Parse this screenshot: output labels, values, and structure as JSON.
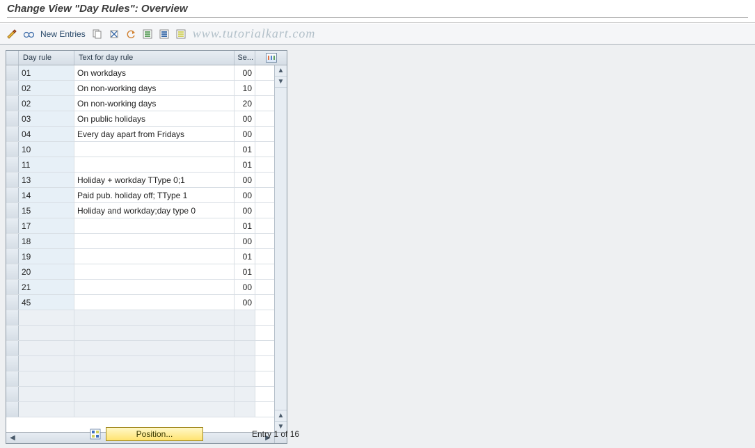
{
  "title": "Change View \"Day Rules\": Overview",
  "toolbar": {
    "new_entries_label": "New Entries"
  },
  "watermark": "www.tutorialkart.com",
  "headers": {
    "day_rule": "Day rule",
    "text": "Text for day rule",
    "se": "Se..."
  },
  "rows": [
    {
      "rule": "01",
      "text": "On workdays",
      "se": "00"
    },
    {
      "rule": "02",
      "text": "On non-working days",
      "se": "10"
    },
    {
      "rule": "02",
      "text": "On non-working days",
      "se": "20"
    },
    {
      "rule": "03",
      "text": "On public holidays",
      "se": "00"
    },
    {
      "rule": "04",
      "text": "Every day apart from Fridays",
      "se": "00"
    },
    {
      "rule": "10",
      "text": "",
      "se": "01"
    },
    {
      "rule": "11",
      "text": "",
      "se": "01"
    },
    {
      "rule": "13",
      "text": "Holiday + workday TType 0;1",
      "se": "00"
    },
    {
      "rule": "14",
      "text": "Paid pub. holiday off; TType 1",
      "se": "00"
    },
    {
      "rule": "15",
      "text": "Holiday and workday;day type 0",
      "se": "00"
    },
    {
      "rule": "17",
      "text": "",
      "se": "01"
    },
    {
      "rule": "18",
      "text": "",
      "se": "00"
    },
    {
      "rule": "19",
      "text": "",
      "se": "01"
    },
    {
      "rule": "20",
      "text": "",
      "se": "01"
    },
    {
      "rule": "21",
      "text": "",
      "se": "00"
    },
    {
      "rule": "45",
      "text": "",
      "se": "00"
    }
  ],
  "empty_rows": 7,
  "position_button": "Position...",
  "entry_label": "Entry 1 of 16"
}
